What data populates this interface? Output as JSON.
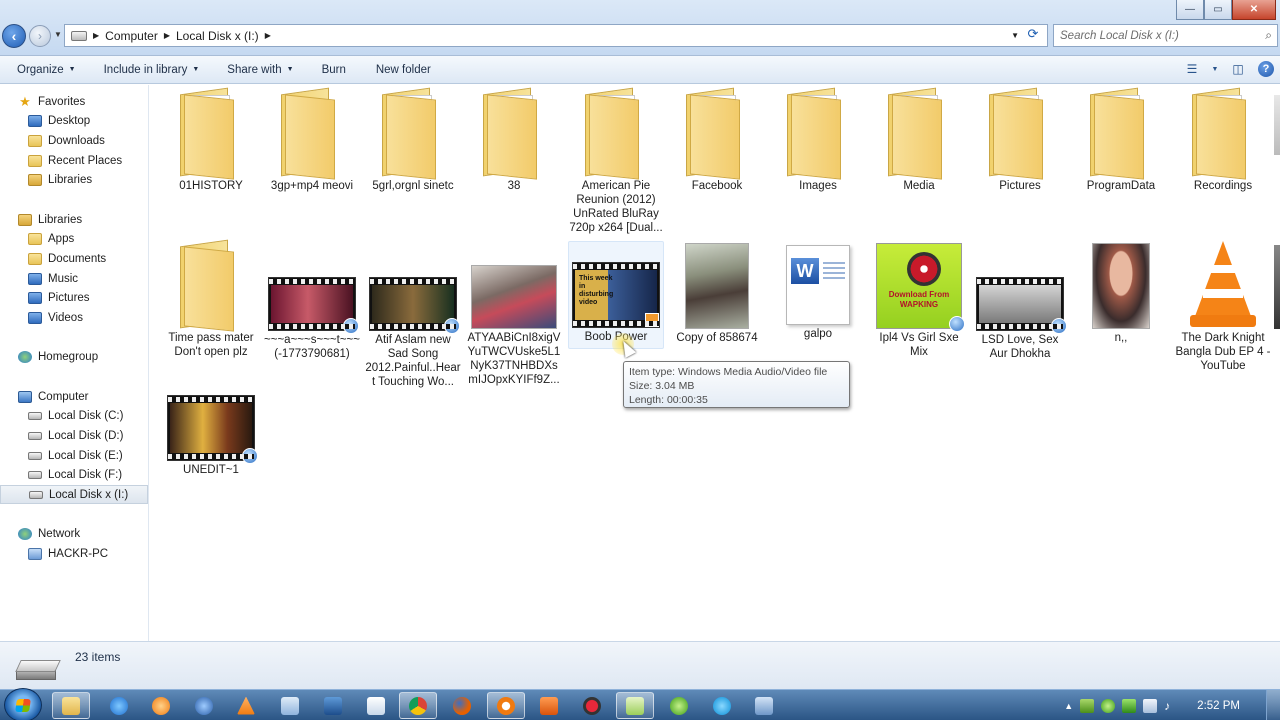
{
  "window": {
    "buttons": {
      "minimize": "—",
      "maximize": "▭",
      "close": "✕"
    },
    "breadcrumb": [
      "Computer",
      "Local Disk x (I:)"
    ],
    "search_placeholder": "Search Local Disk x (I:)"
  },
  "toolbar": {
    "organize": "Organize",
    "include_in_library": "Include in library",
    "share_with": "Share with",
    "burn": "Burn",
    "new_folder": "New folder"
  },
  "sidebar": {
    "favorites": {
      "label": "Favorites",
      "items": [
        "Desktop",
        "Downloads",
        "Recent Places",
        "Libraries"
      ]
    },
    "libraries": {
      "label": "Libraries",
      "items": [
        "Apps",
        "Documents",
        "Music",
        "Pictures",
        "Videos"
      ]
    },
    "homegroup": {
      "label": "Homegroup"
    },
    "computer": {
      "label": "Computer",
      "items": [
        "Local Disk (C:)",
        "Local Disk (D:)",
        "Local Disk (E:)",
        "Local Disk (F:)",
        "Local Disk x (I:)"
      ],
      "selected": "Local Disk x (I:)"
    },
    "network": {
      "label": "Network",
      "items": [
        "HACKR-PC"
      ]
    }
  },
  "files": [
    {
      "name": "01HISTORY",
      "type": "folder"
    },
    {
      "name": "3gp+mp4 meovi",
      "type": "folder"
    },
    {
      "name": "5grl,orgnl sinetc",
      "type": "folder"
    },
    {
      "name": "38",
      "type": "folder"
    },
    {
      "name": "American Pie Reunion (2012) UnRated BluRay 720p x264 [Dual...",
      "type": "folder"
    },
    {
      "name": "Facebook",
      "type": "folder"
    },
    {
      "name": "Images",
      "type": "folder"
    },
    {
      "name": "Media",
      "type": "folder"
    },
    {
      "name": "Pictures",
      "type": "folder"
    },
    {
      "name": "ProgramData",
      "type": "folder"
    },
    {
      "name": "Recordings",
      "type": "folder"
    },
    {
      "name": "Time pass mater Don't open plz",
      "type": "folder"
    },
    {
      "name": "~~~a~~~s~~~t~~~ (-1773790681)",
      "type": "video"
    },
    {
      "name": "Atif Aslam new Sad Song 2012.Painful..Heart Touching Wo...",
      "type": "video"
    },
    {
      "name": "ATYAABiCnI8xigVYuTWCVUske5L1NyK37TNHBDXsmIJOpxKYIFf9Z...",
      "type": "image"
    },
    {
      "name": "Boob Power",
      "type": "video",
      "thumb_text": "This week in disturbing video"
    },
    {
      "name": "Copy of 858674",
      "type": "image"
    },
    {
      "name": "galpo",
      "type": "document"
    },
    {
      "name": "Ipl4 Vs Girl Sxe Mix",
      "type": "image",
      "thumb_text": "Download From WAPKING"
    },
    {
      "name": "LSD Love, Sex Aur Dhokha",
      "type": "video"
    },
    {
      "name": "n,,",
      "type": "image"
    },
    {
      "name": "The Dark Knight Bangla Dub EP 4 - YouTube",
      "type": "vlc"
    },
    {
      "name": "UNEDIT~1",
      "type": "video"
    }
  ],
  "tooltip": {
    "item_type": "Item type: Windows Media Audio/Video file",
    "size": "Size: 3.04 MB",
    "length": "Length: 00:00:35"
  },
  "status": {
    "item_count": "23 items"
  },
  "taskbar": {
    "clock": "2:52 PM"
  },
  "colors": {
    "folder": "#f2cb6a",
    "selection": "#eef5fd",
    "taskbar": "#2b5585"
  }
}
